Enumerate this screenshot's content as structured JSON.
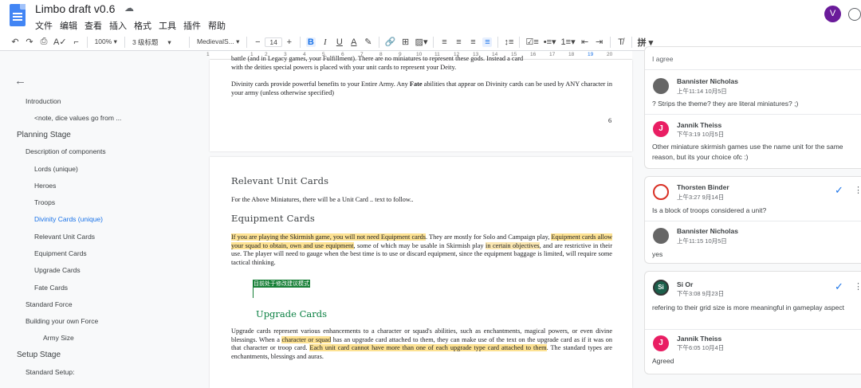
{
  "app": {
    "title": "Limbo draft v0.6",
    "avatar_letter": "V"
  },
  "menu": [
    "文件",
    "编辑",
    "查看",
    "插入",
    "格式",
    "工具",
    "插件",
    "帮助"
  ],
  "toolbar": {
    "zoom": "100%",
    "style": "3 级标题",
    "font": "MedievalS...",
    "font_size": "14",
    "bold": "B",
    "italic": "I",
    "underline": "U",
    "textcolor": "A",
    "input_tools": "拼"
  },
  "ruler": [
    "1",
    "1",
    "2",
    "3",
    "4",
    "5",
    "6",
    "7",
    "8",
    "9",
    "10",
    "11",
    "12",
    "13",
    "14",
    "15",
    "16",
    "17",
    "18",
    "19",
    "20"
  ],
  "outline": {
    "items": [
      {
        "label": "Introduction"
      },
      {
        "label": "<note, dice values go from ..."
      },
      {
        "label": "Planning Stage"
      },
      {
        "label": "Description of components"
      },
      {
        "label": "Lords (unique)"
      },
      {
        "label": "Heroes"
      },
      {
        "label": "Troops"
      },
      {
        "label": "Divinity Cards (unique)"
      },
      {
        "label": "Relevant Unit Cards"
      },
      {
        "label": "Equipment Cards"
      },
      {
        "label": "Upgrade Cards"
      },
      {
        "label": "Fate Cards"
      },
      {
        "label": "Standard Force"
      },
      {
        "label": "Building your own Force"
      },
      {
        "label": "Army Size"
      },
      {
        "label": "Setup Stage"
      },
      {
        "label": "Standard Setup:"
      }
    ]
  },
  "page1": {
    "top_line1": "battle (and in Legacy games, your Fulfillment). There are no miniatures to represent these gods. Instead a card",
    "top_line2": "with the deities special powers is placed with your unit cards to represent your Deity.",
    "para_a": "Divinity cards provide powerful benefits to your Entire Army. Any ",
    "para_bold": "Fate",
    "para_b": " abilities that appear on Divinity cards can be used by ANY character in your army (unless otherwise specified)",
    "page_number": "6"
  },
  "page2": {
    "h_relevant": "Relevant Unit Cards",
    "relevant_text": "For the Above Miniatures, there will be a Unit Card .. text to follow..",
    "h_equipment": "Equipment Cards",
    "eq_hl1": "If you are playing the Skirmish game, you will not need Equipment cards",
    "eq_t1": ". They are mostly for Solo and Campaign play, ",
    "eq_hl2": "Equipment cards allow your squad to obtain, own and use equipment",
    "eq_t2": ", some of which may be usable in Skirmish play ",
    "eq_hl3": "in certain objectives",
    "eq_t3": ", and are restrictive in their use. The player will need to gauge when the best time is to use or discard equipment, since the equipment baggage is limited, will require some tactical thinking.",
    "suggestion_tag": "目前处于修改建议模式",
    "h_upgrade": "Upgrade Cards",
    "up_t1": "Upgrade cards represent various enhancements to a character or squad's abilities, such as enchantments, magical powers, or even divine blessings. When a ",
    "up_hl1": "character or squad",
    "up_t2": " has an upgrade card attached to them, they can make use of the text on the upgrade card as if it was on that character or troop card. ",
    "up_hl2": "Each unit card cannot have more than one of each upgrade type card attached to them",
    "up_t3": ". The standard types are enchantments, blessings and auras."
  },
  "comments": {
    "c0_tail": "I agree",
    "c1": {
      "name": "Bannister Nicholas",
      "time": "上午11:14 10月5日",
      "text": "? Strips the theme? they are literal miniatures? ;)"
    },
    "c2": {
      "name": "Jannik Theiss",
      "time": "下午3:19 10月5日",
      "text": "Other miniature skirmish games use the name unit for the same reason, but its your choice ofc :)"
    },
    "c3": {
      "name": "Thorsten Binder",
      "time": "上午3:27 9月14日",
      "text": "Is a block of troops considered a unit?"
    },
    "c4": {
      "name": "Bannister Nicholas",
      "time": "上午11:15 10月5日",
      "text": "yes"
    },
    "c5": {
      "name": "Si Or",
      "time": "下午3:08 9月23日",
      "text": "refering to their grid size is more meaningful in gameplay aspect",
      "avatar": "Si"
    },
    "c6": {
      "name": "Jannik Theiss",
      "time": "下午6:05 10月4日",
      "text": "Agreed",
      "avatar": "J"
    }
  }
}
